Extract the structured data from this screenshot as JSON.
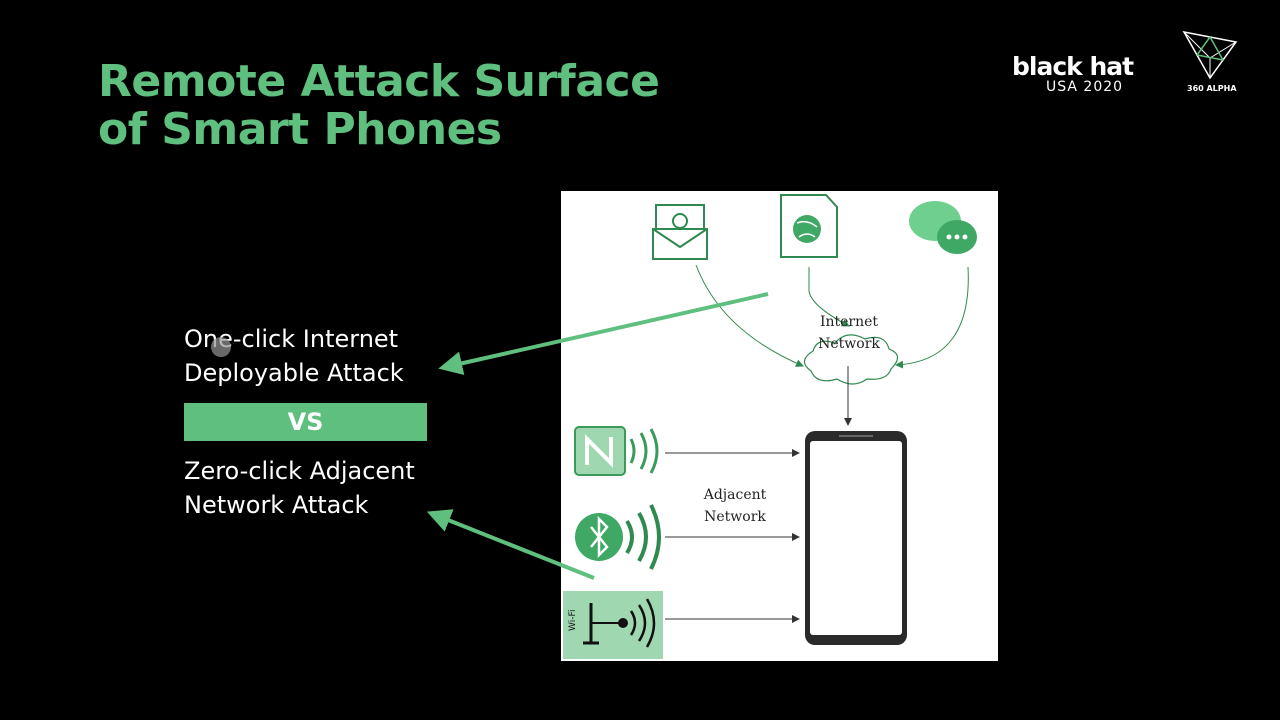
{
  "slide": {
    "title_line1": "Remote Attack Surface",
    "title_line2": "of Smart Phones"
  },
  "logos": {
    "blackhat_word": "black hat",
    "blackhat_sub": "USA 2020",
    "alpha_text": "360 ALPHA"
  },
  "left": {
    "one_click_line1": "One-click Internet",
    "one_click_line2": "Deployable Attack",
    "vs": "VS",
    "zero_click_line1": "Zero-click Adjacent",
    "zero_click_line2": "Network Attack"
  },
  "diagram": {
    "internet_line1": "Internet",
    "internet_line2": "Network",
    "adjacent_line1": "Adjacent",
    "adjacent_line2": "Network",
    "wifi_label": "Wi-Fi",
    "icons": [
      "email-icon",
      "web-document-icon",
      "chat-bubble-icon",
      "cloud-icon",
      "nfc-icon",
      "bluetooth-icon",
      "wifi-icon",
      "smartphone-icon"
    ]
  },
  "colors": {
    "accent": "#5fbf7f",
    "background": "#000000",
    "diagram_green": "#3a9a5a"
  }
}
